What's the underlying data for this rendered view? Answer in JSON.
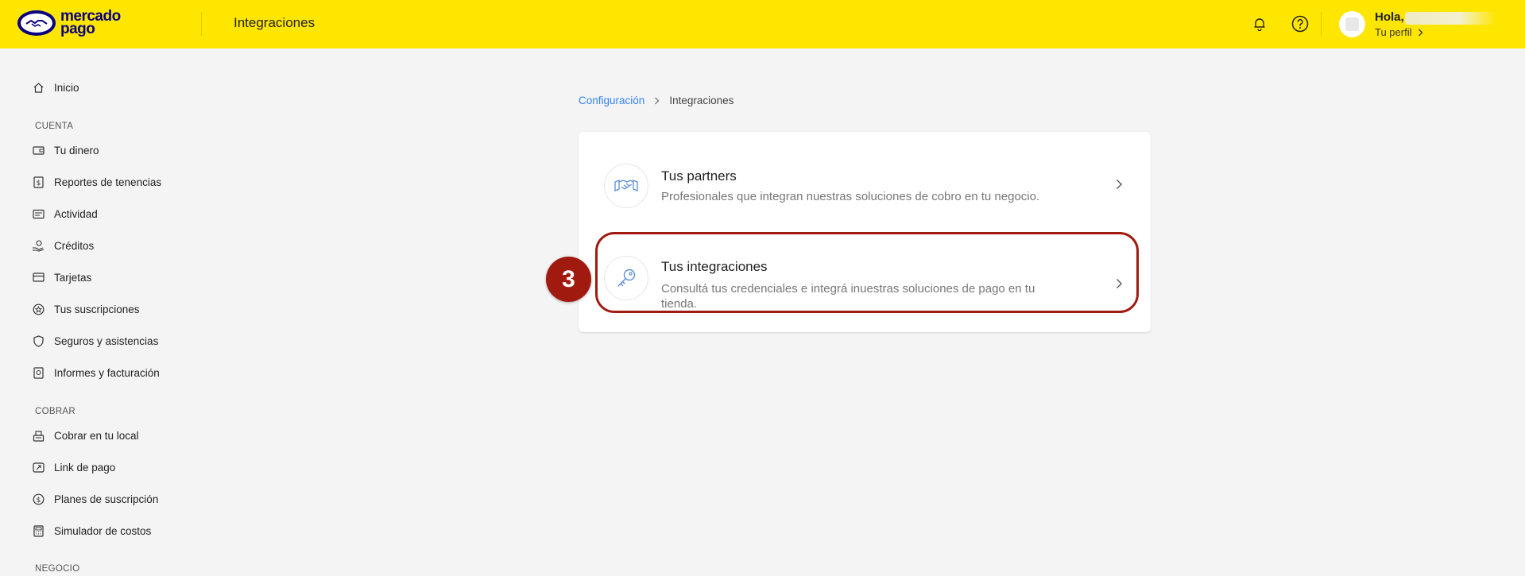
{
  "header": {
    "logo_line1": "mercado",
    "logo_line2": "pago",
    "title": "Integraciones",
    "greeting": "Hola,",
    "profile_link": "Tu perfil"
  },
  "sidebar": {
    "home": "Inicio",
    "sections": [
      {
        "title": "CUENTA",
        "items": [
          "Tu dinero",
          "Reportes de tenencias",
          "Actividad",
          "Créditos",
          "Tarjetas",
          "Tus suscripciones",
          "Seguros y asistencias",
          "Informes y facturación"
        ]
      },
      {
        "title": "COBRAR",
        "items": [
          "Cobrar en tu local",
          "Link de pago",
          "Planes de suscripción",
          "Simulador de costos"
        ]
      },
      {
        "title": "NEGOCIO",
        "items": []
      }
    ]
  },
  "breadcrumb": {
    "parent": "Configuración",
    "current": "Integraciones"
  },
  "card": {
    "rows": [
      {
        "title": "Tus partners",
        "description": "Profesionales que integran nuestras soluciones de cobro en tu negocio.",
        "icon": "handshake-icon"
      },
      {
        "title": "Tus integraciones",
        "description_line1": "Consultá tus credenciales e integrá inuestras soluciones de pago en tu",
        "description_line2": "tienda.",
        "icon": "key-icon"
      }
    ]
  },
  "annotation": {
    "step_number": "3"
  },
  "colors": {
    "header_bg": "#ffe600",
    "brand_navy": "#0a0080",
    "link_blue": "#3483fa",
    "annotation_red": "#a11a10"
  }
}
